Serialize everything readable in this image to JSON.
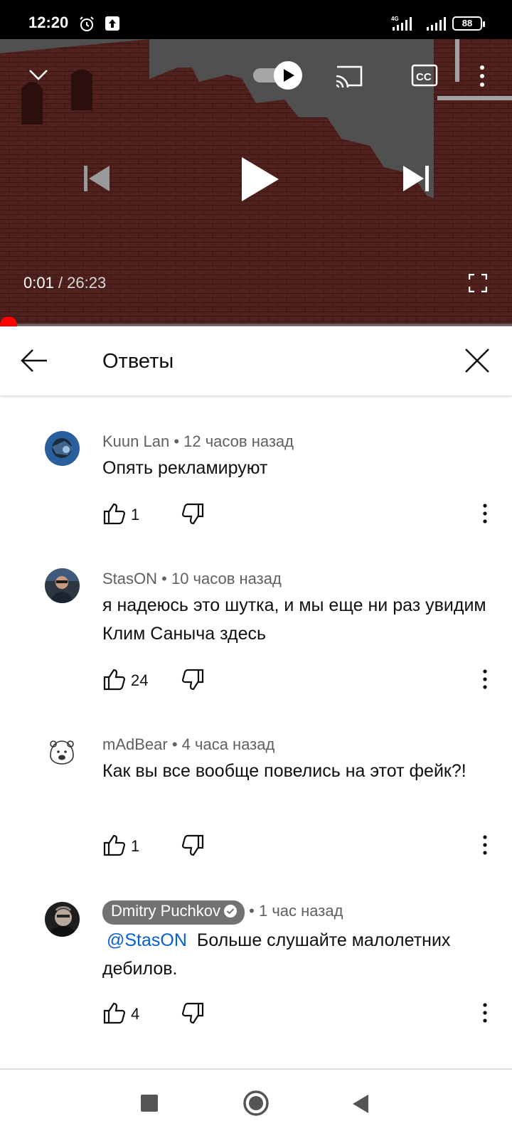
{
  "status_bar": {
    "time": "12:20",
    "network_label": "4G",
    "battery": "88"
  },
  "player": {
    "current_time": "0:01",
    "separator": " / ",
    "duration": "26:23",
    "progress": 0.0006,
    "icons": [
      "collapse-chevron",
      "autoplay-toggle",
      "cast",
      "captions",
      "more",
      "previous",
      "play",
      "next",
      "fullscreen"
    ]
  },
  "replies_panel": {
    "title": "Ответы"
  },
  "comments": [
    {
      "author": "Kuun Lan",
      "time": " • 12 часов назад",
      "text": "Опять рекламируют",
      "likes": "1"
    },
    {
      "author": "StasON",
      "time": " • 10 часов назад",
      "text": "я надеюсь это шутка, и мы еще ни раз увидим Клим Саныча здесь",
      "likes": "24"
    },
    {
      "author": "mAdBear",
      "time": " • 4 часа назад",
      "text": "Как вы все вообще повелись на этот фейк?!",
      "likes": "1"
    },
    {
      "author": "Dmitry Puchkov",
      "time": " • 1 час назад",
      "mention": "@StasON",
      "text": "Больше слушайте малолетних дебилов.",
      "likes": "4",
      "verified": true
    }
  ],
  "nav_bar": {
    "buttons": [
      "recents",
      "home",
      "back"
    ]
  },
  "colors": {
    "accent_red": "#ff0000",
    "mention_blue": "#065fd4",
    "meta_gray": "#606060",
    "chip_gray": "#727272"
  }
}
